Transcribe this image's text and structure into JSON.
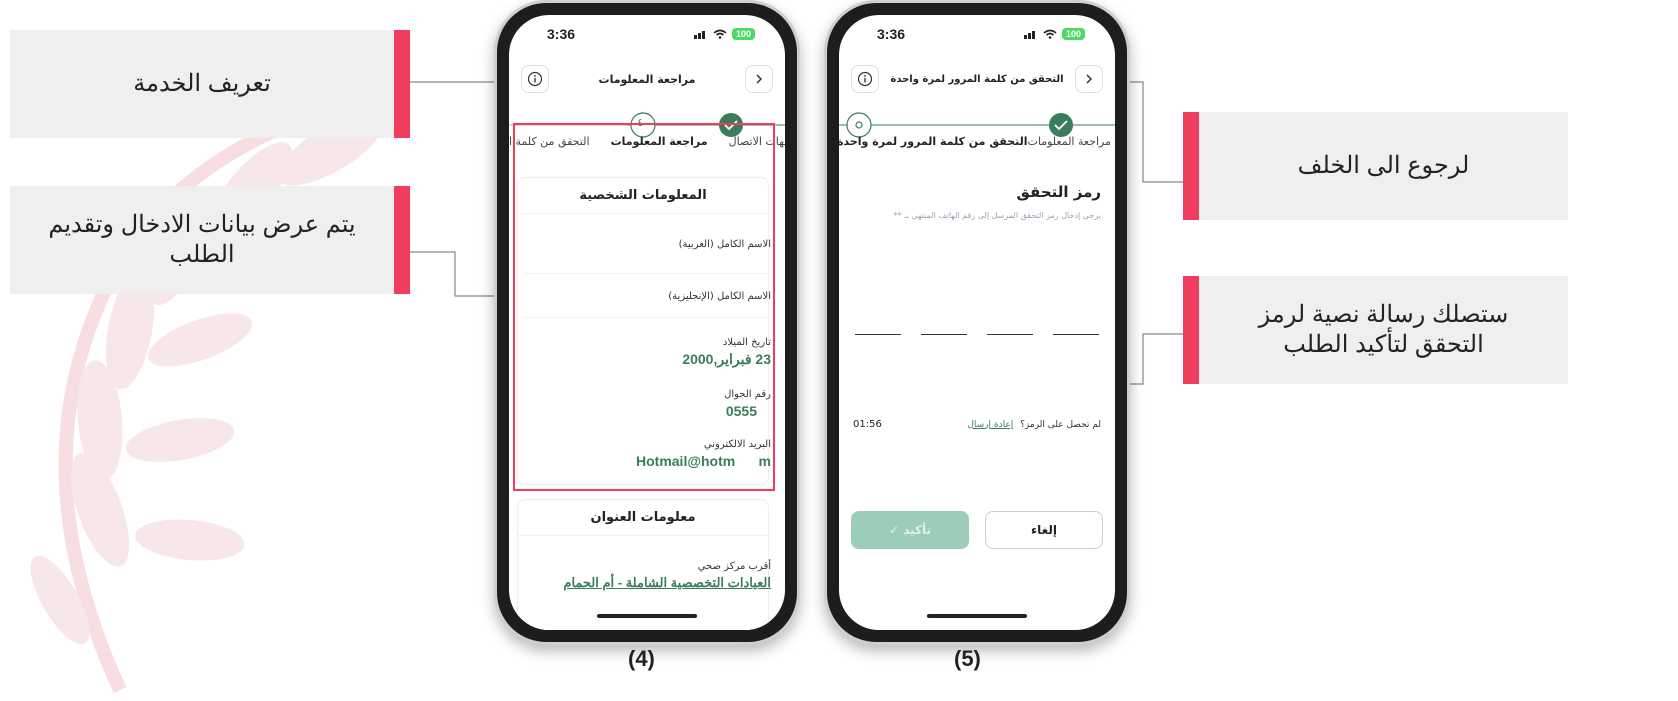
{
  "callouts": {
    "service_def": "تعريف الخدمة",
    "display_data": "يتم عرض بيانات الادخال وتقديم الطلب",
    "go_back": "لرجوع الى الخلف",
    "sms_notice": "ستصلك رسالة نصية لرمز التحقق لتأكيد الطلب"
  },
  "phone4": {
    "time": "3:36",
    "battery": "100",
    "title": "مراجعة المعلومات",
    "step_number": "٤",
    "steps": [
      "جهات الاتصال",
      "مراجعة المعلومات",
      "التحقق من كلمة ا"
    ],
    "personal": {
      "heading": "المعلومات الشخصية",
      "name_ar_label": "الاسم الكامل (العربية)",
      "name_en_label": "الاسم الكامل (الإنجليزية)",
      "dob_label": "تاريخ الميلاد",
      "dob_value": "23 فبراير,2000",
      "mobile_label": "رقم الجوال",
      "mobile_value": "0555",
      "email_label": "البريد الالكتروني",
      "email_value": "Hotmail@hotm      m"
    },
    "address": {
      "heading": "معلومات العنوان",
      "health_center_label": "أقرب مركز صحي",
      "health_center_value": "العيادات التخصصية الشاملة - أم الحمام"
    },
    "caption": "(4)"
  },
  "phone5": {
    "time": "3:36",
    "battery": "100",
    "title": "التحقق من كلمة المرور لمرة واحدة",
    "steps": [
      "مراجعة المعلومات",
      "التحقق من كلمة المرور لمرة واحدة"
    ],
    "otp_title": "رمز التحقق",
    "otp_sub": "يرجى إدخال رمز التحقق المرسل إلى رقم الهاتف المنتهي بـ **",
    "resend_question": "لم تحصل على الرمز؟",
    "resend_link": "إعادة إرسال",
    "timer": "01:56",
    "confirm_label": "تأكيد ✓",
    "cancel_label": "إلغاء",
    "caption": "(5)"
  },
  "colors": {
    "accent_red": "#f03d5f",
    "brand_green": "#3b7d5a",
    "confirm_disabled": "#9ccdb8",
    "callout_bg": "#efefef"
  }
}
